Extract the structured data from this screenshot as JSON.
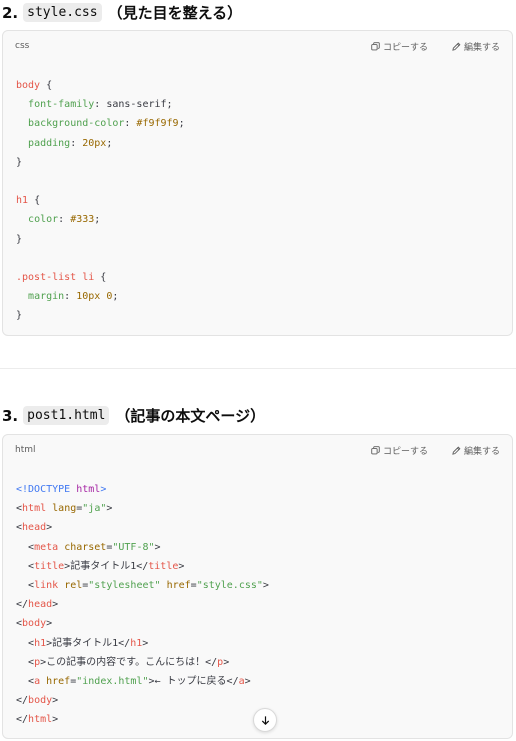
{
  "section1": {
    "number": "2.",
    "filename": "style.css",
    "description": "（見た目を整える）",
    "lang": "css",
    "copy_label": "コピーする",
    "edit_label": "編集する",
    "code": [
      [
        {
          "t": "body",
          "c": "sel"
        },
        {
          "t": " {",
          "c": "p"
        }
      ],
      [
        {
          "t": "  ",
          "c": "p"
        },
        {
          "t": "font-family",
          "c": "prop"
        },
        {
          "t": ": sans-serif;",
          "c": "p"
        }
      ],
      [
        {
          "t": "  ",
          "c": "p"
        },
        {
          "t": "background-color",
          "c": "prop"
        },
        {
          "t": ": ",
          "c": "p"
        },
        {
          "t": "#f9f9f9",
          "c": "num"
        },
        {
          "t": ";",
          "c": "p"
        }
      ],
      [
        {
          "t": "  ",
          "c": "p"
        },
        {
          "t": "padding",
          "c": "prop"
        },
        {
          "t": ": ",
          "c": "p"
        },
        {
          "t": "20px",
          "c": "num"
        },
        {
          "t": ";",
          "c": "p"
        }
      ],
      [
        {
          "t": "}",
          "c": "p"
        }
      ],
      [],
      [
        {
          "t": "h1",
          "c": "sel"
        },
        {
          "t": " {",
          "c": "p"
        }
      ],
      [
        {
          "t": "  ",
          "c": "p"
        },
        {
          "t": "color",
          "c": "prop"
        },
        {
          "t": ": ",
          "c": "p"
        },
        {
          "t": "#333",
          "c": "num"
        },
        {
          "t": ";",
          "c": "p"
        }
      ],
      [
        {
          "t": "}",
          "c": "p"
        }
      ],
      [],
      [
        {
          "t": ".post-list li",
          "c": "sel"
        },
        {
          "t": " {",
          "c": "p"
        }
      ],
      [
        {
          "t": "  ",
          "c": "p"
        },
        {
          "t": "margin",
          "c": "prop"
        },
        {
          "t": ": ",
          "c": "p"
        },
        {
          "t": "10px 0",
          "c": "num"
        },
        {
          "t": ";",
          "c": "p"
        }
      ],
      [
        {
          "t": "}",
          "c": "p"
        }
      ]
    ]
  },
  "section2": {
    "number": "3.",
    "filename": "post1.html",
    "description": "（記事の本文ページ）",
    "lang": "html",
    "copy_label": "コピーする",
    "edit_label": "編集する",
    "code": [
      [
        {
          "t": "<!DOCTYPE ",
          "c": "doc"
        },
        {
          "t": "html",
          "c": "kw"
        },
        {
          "t": ">",
          "c": "doc"
        }
      ],
      [
        {
          "t": "<",
          "c": "p"
        },
        {
          "t": "html",
          "c": "tag"
        },
        {
          "t": " ",
          "c": "p"
        },
        {
          "t": "lang",
          "c": "attr"
        },
        {
          "t": "=",
          "c": "p"
        },
        {
          "t": "\"ja\"",
          "c": "str"
        },
        {
          "t": ">",
          "c": "p"
        }
      ],
      [
        {
          "t": "<",
          "c": "p"
        },
        {
          "t": "head",
          "c": "tag"
        },
        {
          "t": ">",
          "c": "p"
        }
      ],
      [
        {
          "t": "  <",
          "c": "p"
        },
        {
          "t": "meta",
          "c": "tag"
        },
        {
          "t": " ",
          "c": "p"
        },
        {
          "t": "charset",
          "c": "attr"
        },
        {
          "t": "=",
          "c": "p"
        },
        {
          "t": "\"UTF-8\"",
          "c": "str"
        },
        {
          "t": ">",
          "c": "p"
        }
      ],
      [
        {
          "t": "  <",
          "c": "p"
        },
        {
          "t": "title",
          "c": "tag"
        },
        {
          "t": ">記事タイトル1</",
          "c": "p"
        },
        {
          "t": "title",
          "c": "tag"
        },
        {
          "t": ">",
          "c": "p"
        }
      ],
      [
        {
          "t": "  <",
          "c": "p"
        },
        {
          "t": "link",
          "c": "tag"
        },
        {
          "t": " ",
          "c": "p"
        },
        {
          "t": "rel",
          "c": "attr"
        },
        {
          "t": "=",
          "c": "p"
        },
        {
          "t": "\"stylesheet\"",
          "c": "str"
        },
        {
          "t": " ",
          "c": "p"
        },
        {
          "t": "href",
          "c": "attr"
        },
        {
          "t": "=",
          "c": "p"
        },
        {
          "t": "\"style.css\"",
          "c": "str"
        },
        {
          "t": ">",
          "c": "p"
        }
      ],
      [
        {
          "t": "</",
          "c": "p"
        },
        {
          "t": "head",
          "c": "tag"
        },
        {
          "t": ">",
          "c": "p"
        }
      ],
      [
        {
          "t": "<",
          "c": "p"
        },
        {
          "t": "body",
          "c": "tag"
        },
        {
          "t": ">",
          "c": "p"
        }
      ],
      [
        {
          "t": "  <",
          "c": "p"
        },
        {
          "t": "h1",
          "c": "tag"
        },
        {
          "t": ">記事タイトル1</",
          "c": "p"
        },
        {
          "t": "h1",
          "c": "tag"
        },
        {
          "t": ">",
          "c": "p"
        }
      ],
      [
        {
          "t": "  <",
          "c": "p"
        },
        {
          "t": "p",
          "c": "tag"
        },
        {
          "t": ">この記事の内容です。こんにちは！</",
          "c": "p"
        },
        {
          "t": "p",
          "c": "tag"
        },
        {
          "t": ">",
          "c": "p"
        }
      ],
      [
        {
          "t": "  <",
          "c": "p"
        },
        {
          "t": "a",
          "c": "tag"
        },
        {
          "t": " ",
          "c": "p"
        },
        {
          "t": "href",
          "c": "attr"
        },
        {
          "t": "=",
          "c": "p"
        },
        {
          "t": "\"index.html\"",
          "c": "str"
        },
        {
          "t": ">← トップに戻る</",
          "c": "p"
        },
        {
          "t": "a",
          "c": "tag"
        },
        {
          "t": ">",
          "c": "p"
        }
      ],
      [
        {
          "t": "</",
          "c": "p"
        },
        {
          "t": "body",
          "c": "tag"
        },
        {
          "t": ">",
          "c": "p"
        }
      ],
      [
        {
          "t": "</",
          "c": "p"
        },
        {
          "t": "html",
          "c": "tag"
        },
        {
          "t": ">",
          "c": "p"
        }
      ]
    ]
  },
  "icons": {
    "copy": "copy-icon",
    "edit": "edit-icon",
    "scroll": "arrow-down-icon"
  }
}
